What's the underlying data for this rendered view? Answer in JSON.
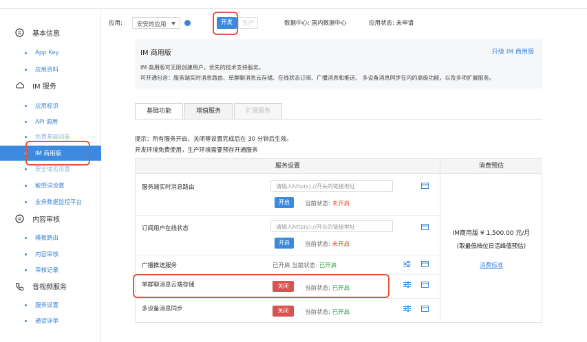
{
  "header": {
    "app_label": "应用:",
    "app_select": "安安的应用",
    "env_dev": "开发",
    "env_prod": "生产",
    "datacenter": "数据中心: 国内数据中心",
    "app_status": "应用状态: 未申请"
  },
  "sidebar": {
    "groups": [
      {
        "label": "基本信息",
        "icon": "info-circle-icon"
      },
      {
        "label": "IM 服务",
        "icon": "cloud-icon"
      },
      {
        "label": "内容审核",
        "icon": "shield-icon"
      },
      {
        "label": "音视频服务",
        "icon": "phone-icon"
      }
    ],
    "items": [
      "App Key",
      "应用资料",
      "应用标识",
      "API 调用",
      "免费基础功能",
      "IM 商用版",
      "安全域名设置",
      "敏感词设置",
      "业务数据监控平台",
      "模板路由",
      "内容审核",
      "审核记录",
      "服务设置",
      "通话详单"
    ]
  },
  "panel": {
    "title": "IM 商用版",
    "upgrade_link": "升级 IM 商用版",
    "desc1": "IM 商用版可无限创建用户，优先的技术支持服务。",
    "desc2": "可开通包含：服务端实时消息路由、单群聊消息云存储、在线状态订阅、广播消息和推送、 多设备消息同步在内的高级功能，以及多项扩展服务。"
  },
  "tabs": [
    "基础功能",
    "增值服务",
    "扩展服务"
  ],
  "tips": {
    "line1": "提示：所有服务开启、关闭等设置完成后在 30 分钟后生效。",
    "line2": "开发环境免费使用，生产环境需要预存开通服务"
  },
  "table": {
    "col_service": "服务设置",
    "col_cost": "消费预估",
    "url_placeholder": "请输入http(s)://开头的链接地址",
    "btn_on": "开启",
    "btn_off": "关闭",
    "status_label": "当前状态:",
    "status_off": "未开启",
    "status_on": "已开启",
    "already_on": "已开启",
    "rows": [
      {
        "name": "服务端实时消息路由"
      },
      {
        "name": "订阅用户在线状态"
      },
      {
        "name": "广播推送服务"
      },
      {
        "name": "单群聊消息云端存储"
      },
      {
        "name": "多设备消息同步"
      }
    ],
    "price_line1": "IM商用版 ¥ 1,500.00 元/月",
    "price_line2": "(取最低档位日活峰值预估)",
    "price_link": "消费标准"
  },
  "colors": {
    "accent": "#3b8ae0",
    "danger": "#d9534f",
    "success": "#37a346",
    "highlight": "#e0553a"
  }
}
